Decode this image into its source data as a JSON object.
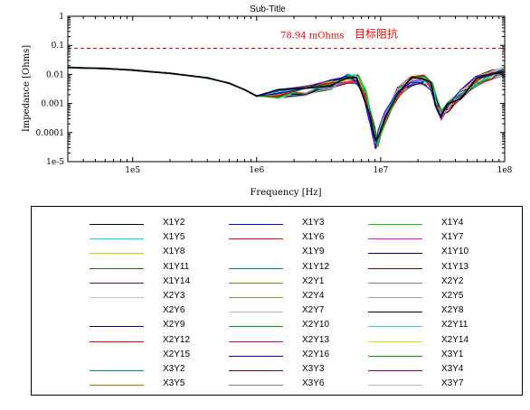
{
  "chart_data": {
    "type": "line",
    "title": "Sub-Title",
    "xlabel": "Frequency [Hz]",
    "ylabel": "Impedance [Ohms]",
    "xscale": "log",
    "yscale": "log",
    "xlim": [
      30000,
      100000000
    ],
    "ylim": [
      1e-05,
      1
    ],
    "x_ticks": [
      {
        "value": 100000,
        "label": "1e5"
      },
      {
        "value": 1000000,
        "label": "1e6"
      },
      {
        "value": 10000000,
        "label": "1e7"
      },
      {
        "value": 100000000,
        "label": "1e8"
      }
    ],
    "y_ticks": [
      {
        "value": 1,
        "label": "1"
      },
      {
        "value": 0.1,
        "label": "0.1"
      },
      {
        "value": 0.01,
        "label": "0.01"
      },
      {
        "value": 0.001,
        "label": "0.001"
      },
      {
        "value": 0.0001,
        "label": "0.0001"
      },
      {
        "value": 1e-05,
        "label": "1e-5"
      }
    ],
    "target": {
      "value": 0.07894,
      "label": "78.94 mOhms",
      "label_cn": "目标阻抗",
      "color": "#ff0000"
    },
    "grid": false,
    "legend_position": "bottom",
    "representative_curve": {
      "x": [
        30000,
        60000,
        100000,
        200000,
        400000,
        600000,
        800000,
        1000000,
        1500000,
        2500000,
        4000000,
        5500000,
        6500000,
        7500000,
        8200000,
        8800000,
        9300000,
        9800000,
        11000000,
        14000000,
        18000000,
        22000000,
        26000000,
        28000000,
        31000000,
        35000000,
        45000000,
        60000000,
        80000000,
        100000000
      ],
      "y": [
        0.017,
        0.016,
        0.014,
        0.011,
        0.0075,
        0.005,
        0.003,
        0.0018,
        0.0021,
        0.0028,
        0.0045,
        0.007,
        0.0065,
        0.002,
        0.00035,
        0.0001,
        4e-05,
        0.0001,
        0.0004,
        0.0025,
        0.006,
        0.0065,
        0.004,
        0.001,
        0.0004,
        0.0008,
        0.002,
        0.006,
        0.01,
        0.012
      ]
    },
    "series": [
      {
        "name": "X1Y2",
        "color": "#000000"
      },
      {
        "name": "X1Y3",
        "color": "#0000ff"
      },
      {
        "name": "X1Y4",
        "color": "#00cc00"
      },
      {
        "name": "X1Y5",
        "color": "#00dddd"
      },
      {
        "name": "X1Y6",
        "color": "#ff0000"
      },
      {
        "name": "X1Y7",
        "color": "#ff00ff"
      },
      {
        "name": "X1Y8",
        "color": "#cccc00"
      },
      {
        "name": "X1Y9",
        "color": "#ffffff"
      },
      {
        "name": "X1Y10",
        "color": "#000080"
      },
      {
        "name": "X1Y11",
        "color": "#008000"
      },
      {
        "name": "X1Y12",
        "color": "#008080"
      },
      {
        "name": "X1Y13",
        "color": "#800000"
      },
      {
        "name": "X1Y14",
        "color": "#800080"
      },
      {
        "name": "X2Y1",
        "color": "#808000"
      },
      {
        "name": "X2Y2",
        "color": "#808080"
      },
      {
        "name": "X2Y3",
        "color": "#c0c0c0"
      },
      {
        "name": "X2Y4",
        "color": "#999933"
      },
      {
        "name": "X2Y5",
        "color": "#a0a0a0"
      },
      {
        "name": "X2Y6",
        "color": "#ffffff"
      },
      {
        "name": "X2Y7",
        "color": "#bbbbbb"
      },
      {
        "name": "X2Y8",
        "color": "#000000"
      },
      {
        "name": "X2Y9",
        "color": "#000099"
      },
      {
        "name": "X2Y10",
        "color": "#00aa00"
      },
      {
        "name": "X2Y11",
        "color": "#33cccc"
      },
      {
        "name": "X2Y12",
        "color": "#ee0000"
      },
      {
        "name": "X2Y13",
        "color": "#cc00cc"
      },
      {
        "name": "X2Y14",
        "color": "#dddd00"
      },
      {
        "name": "X2Y15",
        "color": "#ffffff"
      },
      {
        "name": "X2Y16",
        "color": "#0000cc"
      },
      {
        "name": "X3Y1",
        "color": "#009900"
      },
      {
        "name": "X3Y2",
        "color": "#008888"
      },
      {
        "name": "X3Y3",
        "color": "#880000"
      },
      {
        "name": "X3Y4",
        "color": "#880088"
      },
      {
        "name": "X3Y5",
        "color": "#888800"
      },
      {
        "name": "X3Y6",
        "color": "#888888"
      },
      {
        "name": "X3Y7",
        "color": "#bbbbbb"
      }
    ]
  }
}
